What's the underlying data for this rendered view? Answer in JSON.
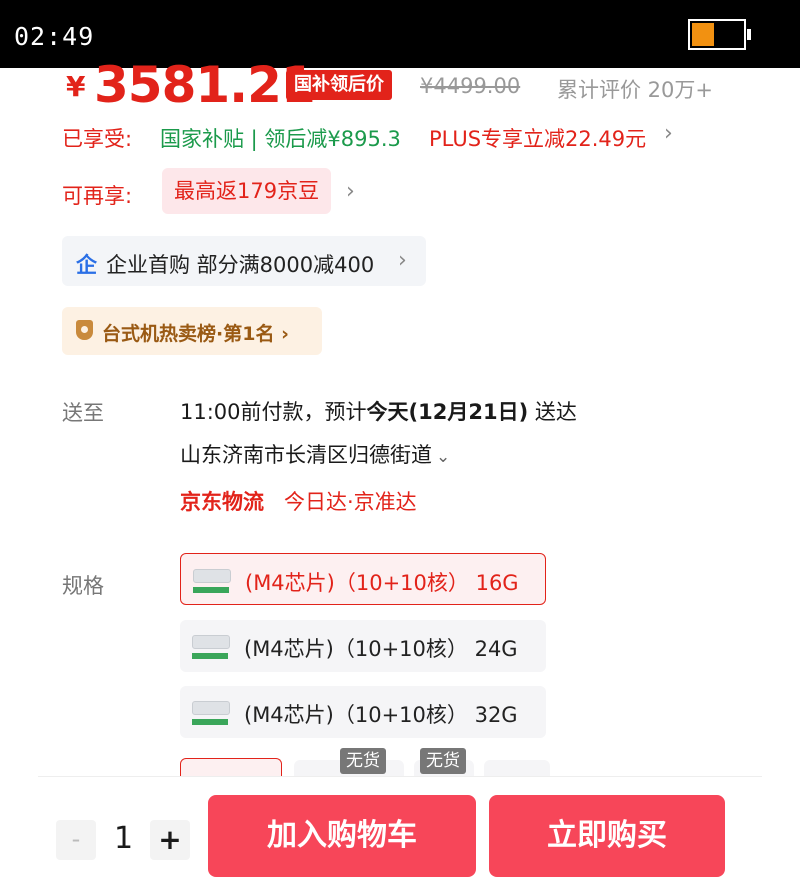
{
  "status_bar": {
    "time": "02:49"
  },
  "price": {
    "currency": "¥",
    "amount": "3581.21",
    "tag": "国补领后价",
    "original": "¥4499.00",
    "reviews": "累计评价 20万+"
  },
  "discounts": {
    "enjoy_label": "已享受:",
    "subsidy": "国家补贴 | 领后减¥895.3",
    "plus": "PLUS专享立减22.49元",
    "more_label": "可再享:",
    "beans": "最高返179京豆"
  },
  "enterprise": {
    "icon": "企",
    "text": "企业首购 部分满8000减400"
  },
  "ranking": {
    "text": "台式机热卖榜·第1名"
  },
  "delivery": {
    "label": "送至",
    "pay_before": "11:00前付款，预计",
    "eta_bold": "今天(12月21日)",
    "eta_suffix": " 送达",
    "address": "山东济南市长清区归德街道",
    "logistics": "京东物流",
    "logistics_sub": "今日达·京准达"
  },
  "specs": {
    "label": "规格",
    "options": [
      {
        "text": "(M4芯片)（10+10核） 16G",
        "selected": true
      },
      {
        "text": "(M4芯片)（10+10核） 24G",
        "selected": false
      },
      {
        "text": "(M4芯片)（10+10核） 32G",
        "selected": false
      }
    ],
    "out_of_stock": "无货"
  },
  "bottom": {
    "minus": "-",
    "quantity": "1",
    "plus": "+",
    "add_to_cart": "加入购物车",
    "buy_now": "立即购买"
  },
  "colors": {
    "price_red": "#e2231a",
    "subsidy_green": "#1b9a4b",
    "button_red": "#f74659",
    "battery_orange": "#f29111"
  }
}
